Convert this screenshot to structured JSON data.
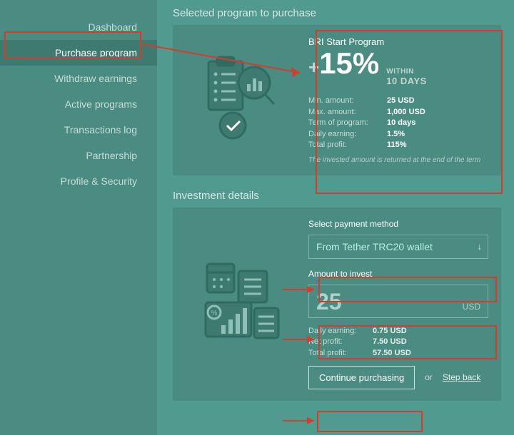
{
  "sidebar": {
    "items": [
      {
        "label": "Dashboard"
      },
      {
        "label": "Purchase program"
      },
      {
        "label": "Withdraw earnings"
      },
      {
        "label": "Active programs"
      },
      {
        "label": "Transactions log"
      },
      {
        "label": "Partnership"
      },
      {
        "label": "Profile & Security"
      }
    ],
    "activeIndex": 1
  },
  "section1": {
    "title": "Selected program to purchase",
    "program": {
      "name": "BRI Start Program",
      "plus": "+",
      "percent": "15%",
      "within": "WITHIN",
      "days": "10 DAYS",
      "stats": [
        {
          "label": "Min. amount:",
          "value": "25 USD"
        },
        {
          "label": "Max. amount:",
          "value": "1,000 USD"
        },
        {
          "label": "Term of program:",
          "value": "10 days"
        },
        {
          "label": "Daily earning:",
          "value": "1.5%"
        },
        {
          "label": "Total profit:",
          "value": "115%"
        }
      ],
      "footnote": "The invested amount is returned at the end of the term"
    }
  },
  "section2": {
    "title": "Investment details",
    "selectLabel": "Select payment method",
    "selectValue": "From Tether TRC20 wallet",
    "amountLabel": "Amount to invest",
    "amountValue": "25",
    "amountCurrency": "USD",
    "details": [
      {
        "label": "Daily earning:",
        "value": "0.75 USD"
      },
      {
        "label": "Net profit:",
        "value": "7.50 USD"
      },
      {
        "label": "Total profit:",
        "value": "57.50 USD"
      }
    ],
    "continue": "Continue purchasing",
    "or": "or",
    "back": "Step back"
  }
}
